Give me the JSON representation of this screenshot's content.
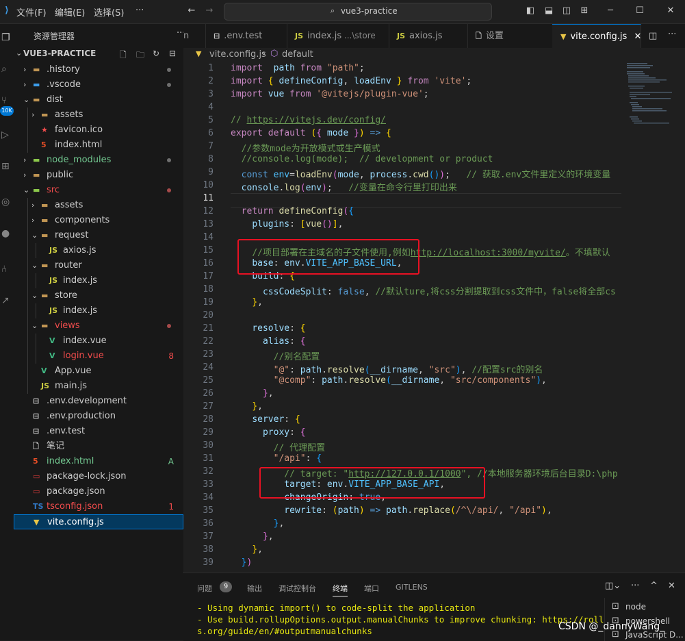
{
  "menu": [
    "文件(F)",
    "编辑(E)",
    "选择(S)",
    "···"
  ],
  "search_text": "vue3-practice",
  "activity_badge": "10K",
  "sidebar": {
    "title": "资源管理器",
    "more": "···",
    "project": "VUE3-PRACTICE",
    "rows": [
      {
        "name": ".history",
        "chev": "›",
        "icon": "folder",
        "color": "#cccccc",
        "dot": true
      },
      {
        "name": ".vscode",
        "chev": "›",
        "icon": "vscode-folder",
        "color": "#cccccc",
        "dot": true
      },
      {
        "name": "dist",
        "chev": "⌄",
        "icon": "folder-open",
        "color": "#cccccc"
      },
      {
        "name": "assets",
        "chev": "›",
        "icon": "folder",
        "color": "#cccccc"
      },
      {
        "name": "favicon.ico",
        "icon": "star-file",
        "color": "#cccccc"
      },
      {
        "name": "index.html",
        "icon": "html5",
        "color": "#cccccc"
      },
      {
        "name": "node_modules",
        "chev": "›",
        "icon": "node-folder",
        "color": "#73c991",
        "dot": true
      },
      {
        "name": "public",
        "chev": "›",
        "icon": "folder",
        "color": "#cccccc"
      },
      {
        "name": "src",
        "chev": "⌄",
        "icon": "src-folder",
        "color": "#f14c4c",
        "dot": true,
        "dotcolor": "#a54a4a"
      },
      {
        "name": "assets",
        "chev": "›",
        "icon": "folder",
        "color": "#cccccc"
      },
      {
        "name": "components",
        "chev": "›",
        "icon": "folder",
        "color": "#cccccc"
      },
      {
        "name": "request",
        "chev": "⌄",
        "icon": "folder-open",
        "color": "#cccccc"
      },
      {
        "name": "axios.js",
        "icon": "js",
        "color": "#cccccc"
      },
      {
        "name": "router",
        "chev": "⌄",
        "icon": "folder-open",
        "color": "#cccccc"
      },
      {
        "name": "index.js",
        "icon": "js",
        "color": "#cccccc"
      },
      {
        "name": "store",
        "chev": "⌄",
        "icon": "folder-open",
        "color": "#cccccc"
      },
      {
        "name": "index.js",
        "icon": "js",
        "color": "#cccccc"
      },
      {
        "name": "views",
        "chev": "⌄",
        "icon": "folder-open",
        "color": "#f14c4c",
        "dot": true,
        "dotcolor": "#a54a4a"
      },
      {
        "name": "index.vue",
        "icon": "vue",
        "color": "#cccccc"
      },
      {
        "name": "login.vue",
        "icon": "vue",
        "color": "#f14c4c",
        "badge": "8",
        "badgecolor": "#f14c4c"
      },
      {
        "name": "App.vue",
        "icon": "vue",
        "color": "#cccccc"
      },
      {
        "name": "main.js",
        "icon": "js",
        "color": "#cccccc"
      },
      {
        "name": ".env.development",
        "icon": "env",
        "color": "#cccccc"
      },
      {
        "name": ".env.production",
        "icon": "env",
        "color": "#cccccc"
      },
      {
        "name": ".env.test",
        "icon": "env",
        "color": "#cccccc"
      },
      {
        "name": "笔记",
        "icon": "file",
        "color": "#cccccc"
      },
      {
        "name": "index.html",
        "icon": "html5",
        "color": "#73c991",
        "badge": "A",
        "badgecolor": "#73c991"
      },
      {
        "name": "package-lock.json",
        "icon": "npm",
        "color": "#cccccc"
      },
      {
        "name": "package.json",
        "icon": "npm",
        "color": "#cccccc"
      },
      {
        "name": "tsconfig.json",
        "icon": "ts",
        "color": "#f14c4c",
        "badge": "1",
        "badgecolor": "#f14c4c"
      },
      {
        "name": "vite.config.js",
        "icon": "vite",
        "color": "#ffffff",
        "selected": true
      }
    ]
  },
  "tabs": [
    {
      "icon": "",
      "label": "n",
      "sub": ""
    },
    {
      "icon": "env",
      "label": ".env.test",
      "sub": ""
    },
    {
      "icon": "JS",
      "label": "index.js",
      "sub": "...\\store"
    },
    {
      "icon": "JS",
      "label": "axios.js",
      "sub": ""
    },
    {
      "icon": "file",
      "label": "设置",
      "sub": ""
    },
    {
      "icon": "vite",
      "label": "vite.config.js",
      "sub": "",
      "active": true
    }
  ],
  "breadcrumb": {
    "file": "vite.config.js",
    "symbol": "default"
  },
  "editor": {
    "current_line": 11,
    "lines": [
      [
        [
          "kw2",
          "import"
        ],
        [
          "",
          "  "
        ],
        [
          "var",
          "path"
        ],
        [
          "",
          " "
        ],
        [
          "kw2",
          "from"
        ],
        [
          "",
          " "
        ],
        [
          "str",
          "\"path\""
        ],
        [
          "",
          ";"
        ]
      ],
      [
        [
          "kw2",
          "import"
        ],
        [
          "",
          " "
        ],
        [
          "b1",
          "{"
        ],
        [
          "",
          " "
        ],
        [
          "var",
          "defineConfig"
        ],
        [
          "",
          ", "
        ],
        [
          "var",
          "loadEnv"
        ],
        [
          "",
          " "
        ],
        [
          "b1",
          "}"
        ],
        [
          "",
          " "
        ],
        [
          "kw2",
          "from"
        ],
        [
          "",
          " "
        ],
        [
          "str",
          "'vite'"
        ],
        [
          "",
          ";"
        ]
      ],
      [
        [
          "kw2",
          "import"
        ],
        [
          "",
          " "
        ],
        [
          "var",
          "vue"
        ],
        [
          "",
          " "
        ],
        [
          "kw2",
          "from"
        ],
        [
          "",
          " "
        ],
        [
          "str",
          "'@vitejs/plugin-vue'"
        ],
        [
          "",
          ";"
        ]
      ],
      [],
      [
        [
          "cm",
          "// "
        ],
        [
          "link",
          "https://vitejs.dev/config/"
        ]
      ],
      [
        [
          "kw2",
          "export"
        ],
        [
          "",
          " "
        ],
        [
          "kw2",
          "default"
        ],
        [
          "",
          " "
        ],
        [
          "b1",
          "("
        ],
        [
          "b2",
          "{"
        ],
        [
          "",
          " "
        ],
        [
          "var",
          "mode"
        ],
        [
          "",
          " "
        ],
        [
          "b2",
          "}"
        ],
        [
          "b1",
          ")"
        ],
        [
          "",
          " "
        ],
        [
          "kw",
          "=>"
        ],
        [
          "",
          " "
        ],
        [
          "b1",
          "{"
        ]
      ],
      [
        [
          "",
          "  "
        ],
        [
          "cm",
          "//参数mode为开放模式或生产模式"
        ]
      ],
      [
        [
          "",
          "  "
        ],
        [
          "cm",
          "//console.log(mode);  // development or product"
        ]
      ],
      [
        [
          "",
          "  "
        ],
        [
          "kw",
          "const"
        ],
        [
          "",
          " "
        ],
        [
          "const",
          "env"
        ],
        [
          "",
          "="
        ],
        [
          "fn",
          "loadEnv"
        ],
        [
          "b2",
          "("
        ],
        [
          "var",
          "mode"
        ],
        [
          "",
          ", "
        ],
        [
          "var",
          "process"
        ],
        [
          "",
          "."
        ],
        [
          "fn",
          "cwd"
        ],
        [
          "b3",
          "()"
        ],
        [
          "b2",
          ")"
        ],
        [
          "",
          ";   "
        ],
        [
          "cm",
          "// 获取.env文件里定义的环境变量"
        ]
      ],
      [
        [
          "",
          "  "
        ],
        [
          "var",
          "console"
        ],
        [
          "",
          "."
        ],
        [
          "fn",
          "log"
        ],
        [
          "b2",
          "("
        ],
        [
          "var",
          "env"
        ],
        [
          "b2",
          ")"
        ],
        [
          "",
          ";   "
        ],
        [
          "cm",
          "//变量在命令行里打印出来"
        ]
      ],
      [],
      [
        [
          "",
          "  "
        ],
        [
          "kw2",
          "return"
        ],
        [
          "",
          " "
        ],
        [
          "fn",
          "defineConfig"
        ],
        [
          "b2",
          "("
        ],
        [
          "b3",
          "{"
        ]
      ],
      [
        [
          "",
          "    "
        ],
        [
          "var",
          "plugins"
        ],
        [
          "",
          ": "
        ],
        [
          "b1",
          "["
        ],
        [
          "fn",
          "vue"
        ],
        [
          "b2",
          "()"
        ],
        [
          "b1",
          "]"
        ],
        [
          "",
          ","
        ]
      ],
      [],
      [
        [
          "",
          "    "
        ],
        [
          "cm",
          "//项目部署在主域名的子文件使用,例如"
        ],
        [
          "link",
          "http://localhost:3000/myvite/"
        ],
        [
          "cm",
          "。不填默认"
        ]
      ],
      [
        [
          "",
          "    "
        ],
        [
          "var",
          "base"
        ],
        [
          "",
          ": "
        ],
        [
          "var",
          "env"
        ],
        [
          "",
          "."
        ],
        [
          "const",
          "VITE_APP_BASE_URL"
        ],
        [
          "",
          ","
        ]
      ],
      [
        [
          "",
          "    "
        ],
        [
          "var",
          "build"
        ],
        [
          "",
          ": "
        ],
        [
          "b1",
          "{"
        ]
      ],
      [
        [
          "",
          "      "
        ],
        [
          "var",
          "cssCodeSplit"
        ],
        [
          "",
          ": "
        ],
        [
          "kw",
          "false"
        ],
        [
          "",
          ", "
        ],
        [
          "cm",
          "//默认ture,将css分割提取到css文件中，false将全部cs"
        ]
      ],
      [
        [
          "",
          "    "
        ],
        [
          "b1",
          "}"
        ],
        [
          "",
          ","
        ]
      ],
      [],
      [
        [
          "",
          "    "
        ],
        [
          "var",
          "resolve"
        ],
        [
          "",
          ": "
        ],
        [
          "b1",
          "{"
        ]
      ],
      [
        [
          "",
          "      "
        ],
        [
          "var",
          "alias"
        ],
        [
          "",
          ": "
        ],
        [
          "b2",
          "{"
        ]
      ],
      [
        [
          "",
          "        "
        ],
        [
          "cm",
          "//别名配置"
        ]
      ],
      [
        [
          "",
          "        "
        ],
        [
          "str",
          "\"@\""
        ],
        [
          "",
          ": "
        ],
        [
          "var",
          "path"
        ],
        [
          "",
          "."
        ],
        [
          "fn",
          "resolve"
        ],
        [
          "b3",
          "("
        ],
        [
          "var",
          "__dirname"
        ],
        [
          "",
          ", "
        ],
        [
          "str",
          "\"src\""
        ],
        [
          "b3",
          ")"
        ],
        [
          "",
          ", "
        ],
        [
          "cm",
          "//配置src的别名"
        ]
      ],
      [
        [
          "",
          "        "
        ],
        [
          "str",
          "\"@comp\""
        ],
        [
          "",
          ": "
        ],
        [
          "var",
          "path"
        ],
        [
          "",
          "."
        ],
        [
          "fn",
          "resolve"
        ],
        [
          "b3",
          "("
        ],
        [
          "var",
          "__dirname"
        ],
        [
          "",
          ", "
        ],
        [
          "str",
          "\"src/components\""
        ],
        [
          "b3",
          ")"
        ],
        [
          "",
          ","
        ]
      ],
      [
        [
          "",
          "      "
        ],
        [
          "b2",
          "}"
        ],
        [
          "",
          ","
        ]
      ],
      [
        [
          "",
          "    "
        ],
        [
          "b1",
          "}"
        ],
        [
          "",
          ","
        ]
      ],
      [
        [
          "",
          "    "
        ],
        [
          "var",
          "server"
        ],
        [
          "",
          ": "
        ],
        [
          "b1",
          "{"
        ]
      ],
      [
        [
          "",
          "      "
        ],
        [
          "var",
          "proxy"
        ],
        [
          "",
          ": "
        ],
        [
          "b2",
          "{"
        ]
      ],
      [
        [
          "",
          "        "
        ],
        [
          "cm",
          "// 代理配置"
        ]
      ],
      [
        [
          "",
          "        "
        ],
        [
          "str",
          "\"/api\""
        ],
        [
          "",
          ": "
        ],
        [
          "b3",
          "{"
        ]
      ],
      [
        [
          "",
          "          "
        ],
        [
          "cm",
          "// target: \""
        ],
        [
          "link",
          "http://127.0.0.1/1000"
        ],
        [
          "cm",
          "\", //本地服务器环境后台目录D:\\php"
        ]
      ],
      [
        [
          "",
          "          "
        ],
        [
          "var",
          "target"
        ],
        [
          "",
          ": "
        ],
        [
          "var",
          "env"
        ],
        [
          "",
          "."
        ],
        [
          "const",
          "VITE_APP_BASE_API"
        ],
        [
          "",
          ","
        ]
      ],
      [
        [
          "",
          "          "
        ],
        [
          "var",
          "changeOrigin"
        ],
        [
          "",
          ": "
        ],
        [
          "kw",
          "true"
        ],
        [
          "",
          ","
        ]
      ],
      [
        [
          "",
          "          "
        ],
        [
          "var",
          "rewrite"
        ],
        [
          "",
          ": "
        ],
        [
          "b1",
          "("
        ],
        [
          "var",
          "path"
        ],
        [
          "b1",
          ")"
        ],
        [
          "",
          " "
        ],
        [
          "kw",
          "=>"
        ],
        [
          "",
          " "
        ],
        [
          "var",
          "path"
        ],
        [
          "",
          "."
        ],
        [
          "fn",
          "replace"
        ],
        [
          "b1",
          "("
        ],
        [
          "str",
          "/^\\/api/"
        ],
        [
          "",
          ", "
        ],
        [
          "str",
          "\"/api\""
        ],
        [
          "b1",
          ")"
        ],
        [
          "",
          ","
        ]
      ],
      [
        [
          "",
          "        "
        ],
        [
          "b3",
          "}"
        ],
        [
          "",
          ","
        ]
      ],
      [
        [
          "",
          "      "
        ],
        [
          "b2",
          "}"
        ],
        [
          "",
          ","
        ]
      ],
      [
        [
          "",
          "    "
        ],
        [
          "b1",
          "}"
        ],
        [
          "",
          ","
        ]
      ],
      [
        [
          "",
          "  "
        ],
        [
          "b3",
          "}"
        ],
        [
          "b2",
          ")"
        ]
      ]
    ]
  },
  "panel": {
    "tabs": [
      "问题",
      "输出",
      "调试控制台",
      "终端",
      "端口",
      "GITLENS"
    ],
    "problems_count": "9",
    "active_tab": "终端",
    "terminal_lines": [
      "- Using dynamic import() to code-split the application",
      "- Use build.rollupOptions.output.manualChunks to improve chunking: https://rollupj",
      "s.org/guide/en/#outputmanualchunks"
    ],
    "terminals": [
      "node",
      "powershell",
      "JavaScript D..."
    ],
    "watermark": "CSDN @_dannyWang_"
  }
}
